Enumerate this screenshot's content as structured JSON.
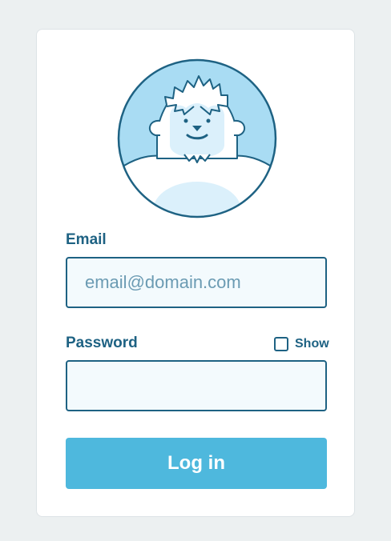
{
  "form": {
    "email_label": "Email",
    "email_placeholder": "email@domain.com",
    "email_value": "",
    "password_label": "Password",
    "password_value": "",
    "show_label": "Show",
    "show_checked": false,
    "login_label": "Log in"
  },
  "avatar": {
    "icon": "yeti-mascot-icon"
  },
  "colors": {
    "page_background": "#ecf0f1",
    "card_background": "#ffffff",
    "accent_dark": "#1e6283",
    "input_background": "#f3fafd",
    "avatar_background": "#a9dcf3",
    "button": "#4eb8dd",
    "button_text": "#ffffff"
  }
}
